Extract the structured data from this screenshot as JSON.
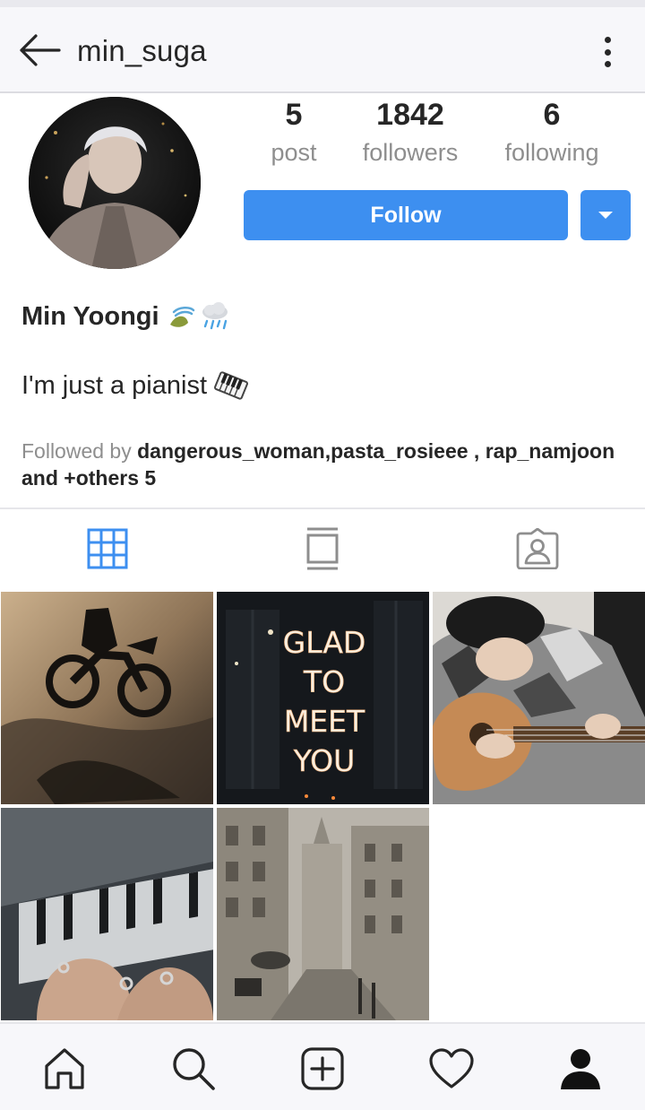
{
  "header": {
    "username": "min_suga",
    "back_icon": "arrow-left-icon",
    "more_icon": "more-vertical-icon"
  },
  "profile": {
    "stats": [
      {
        "value": "5",
        "label": "post"
      },
      {
        "value": "1842",
        "label": "followers"
      },
      {
        "value": "6",
        "label": "following"
      }
    ],
    "follow_label": "Follow",
    "full_name": "Min Yoongi",
    "name_emojis": [
      "wind-leaf-emoji",
      "rain-cloud-emoji"
    ],
    "bio": "I'm just a pianist",
    "bio_emoji": "piano-emoji",
    "followed_by_prefix": "Followed by ",
    "followed_by_names": "dangerous_woman,pasta_rosieee , rap_namjoon",
    "followed_by_suffix": "and +others 5"
  },
  "tabs": [
    {
      "icon": "grid-icon",
      "active": true
    },
    {
      "icon": "feed-list-icon",
      "active": false
    },
    {
      "icon": "tagged-person-icon",
      "active": false
    }
  ],
  "posts": [
    {
      "subject": "motorcycle"
    },
    {
      "subject": "neon-sign",
      "text": [
        "GLAD",
        "TO",
        "MEET",
        "YOU"
      ]
    },
    {
      "subject": "guitar"
    },
    {
      "subject": "piano-keys"
    },
    {
      "subject": "street"
    }
  ],
  "bottom_nav": [
    "home-icon",
    "search-icon",
    "add-post-icon",
    "heart-icon",
    "profile-icon"
  ],
  "colors": {
    "accent": "#3d8ff0",
    "muted_text": "#8e8e8e",
    "primary_text": "#262626",
    "bar_bg": "#f7f7fa"
  }
}
